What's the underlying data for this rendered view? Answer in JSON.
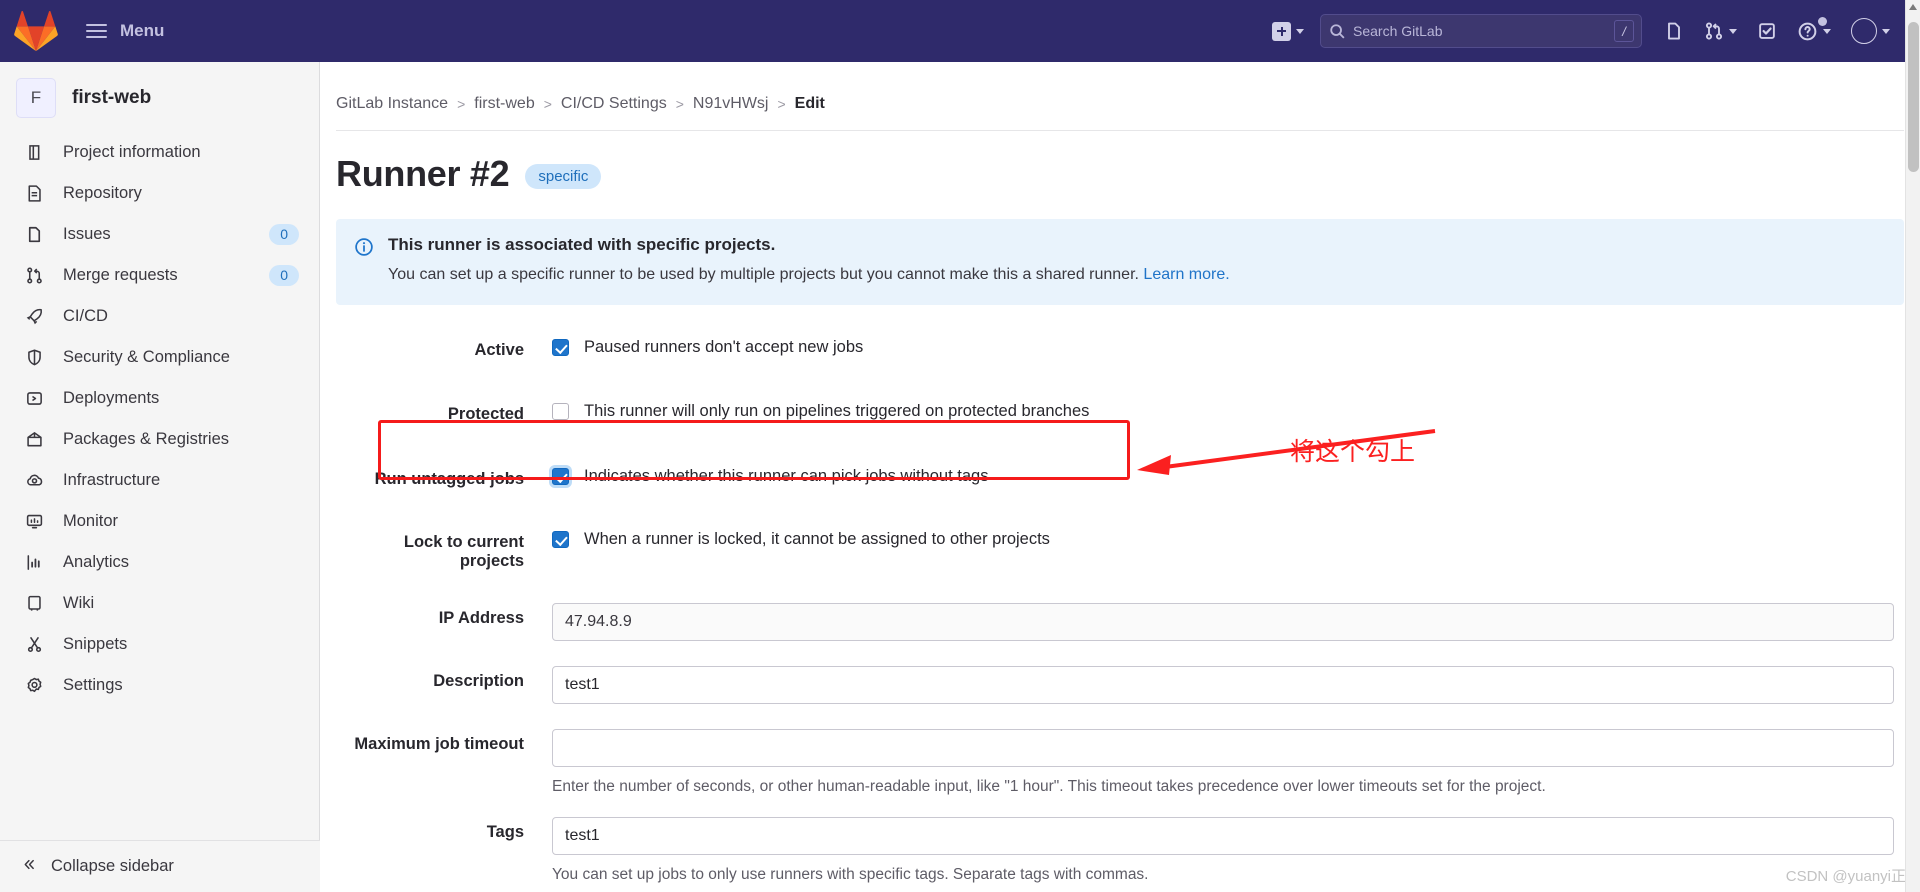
{
  "topnav": {
    "menu_label": "Menu",
    "logo_name": "gitlab-logo",
    "new_dropdown_label": "",
    "search_placeholder": "Search GitLab",
    "search_shortcut": "/",
    "icons": [
      "issues-icon",
      "merge-requests-icon",
      "todos-icon",
      "help-icon",
      "user-avatar"
    ]
  },
  "sidebar": {
    "project_initial": "F",
    "project_name": "first-web",
    "items": [
      {
        "label": "Project information",
        "icon": "project-information-icon",
        "badge": ""
      },
      {
        "label": "Repository",
        "icon": "repository-icon",
        "badge": ""
      },
      {
        "label": "Issues",
        "icon": "issues-icon",
        "badge": "0"
      },
      {
        "label": "Merge requests",
        "icon": "merge-requests-icon",
        "badge": "0"
      },
      {
        "label": "CI/CD",
        "icon": "rocket-icon",
        "badge": ""
      },
      {
        "label": "Security & Compliance",
        "icon": "shield-icon",
        "badge": ""
      },
      {
        "label": "Deployments",
        "icon": "deployments-icon",
        "badge": ""
      },
      {
        "label": "Packages & Registries",
        "icon": "package-icon",
        "badge": ""
      },
      {
        "label": "Infrastructure",
        "icon": "cloud-gear-icon",
        "badge": ""
      },
      {
        "label": "Monitor",
        "icon": "monitor-icon",
        "badge": ""
      },
      {
        "label": "Analytics",
        "icon": "analytics-icon",
        "badge": ""
      },
      {
        "label": "Wiki",
        "icon": "book-icon",
        "badge": ""
      },
      {
        "label": "Snippets",
        "icon": "scissors-icon",
        "badge": ""
      },
      {
        "label": "Settings",
        "icon": "gear-icon",
        "badge": ""
      }
    ],
    "collapse_label": "Collapse sidebar"
  },
  "breadcrumb": {
    "items": [
      "GitLab Instance",
      "first-web",
      "CI/CD Settings",
      "N91vHWsj"
    ],
    "current": "Edit",
    "separator": ">"
  },
  "page": {
    "title": "Runner #2",
    "badge": "specific"
  },
  "alert": {
    "icon": "info-icon",
    "title": "This runner is associated with specific projects.",
    "body": "You can set up a specific runner to be used by multiple projects but you cannot make this a shared runner.",
    "link": "Learn more."
  },
  "form": {
    "active": {
      "label": "Active",
      "checkbox_label": "Paused runners don't accept new jobs",
      "checked": true
    },
    "protected": {
      "label": "Protected",
      "checkbox_label": "This runner will only run on pipelines triggered on protected branches",
      "checked": false
    },
    "run_untagged": {
      "label": "Run untagged jobs",
      "checkbox_label": "Indicates whether this runner can pick jobs without tags",
      "checked": true
    },
    "lock_projects": {
      "label": "Lock to current projects",
      "checkbox_label": "When a runner is locked, it cannot be assigned to other projects",
      "checked": true
    },
    "ip_address": {
      "label": "IP Address",
      "value": "47.94.8.9"
    },
    "description": {
      "label": "Description",
      "value": "test1"
    },
    "max_timeout": {
      "label": "Maximum job timeout",
      "value": "",
      "help": "Enter the number of seconds, or other human-readable input, like \"1 hour\". This timeout takes precedence over lower timeouts set for the project."
    },
    "tags": {
      "label": "Tags",
      "value": "test1",
      "help": "You can set up jobs to only use runners with specific tags. Separate tags with commas."
    }
  },
  "annotation": {
    "text": "将这个勾上",
    "color": "#fb2020"
  },
  "watermark": "CSDN @yuanyi正",
  "colors": {
    "nav_bg": "#2f2a6b",
    "sidebar_bg": "#f5f5f5",
    "accent_blue": "#1f75cb",
    "alert_bg": "#e9f3fc",
    "annotation_red": "#f51b1b"
  }
}
